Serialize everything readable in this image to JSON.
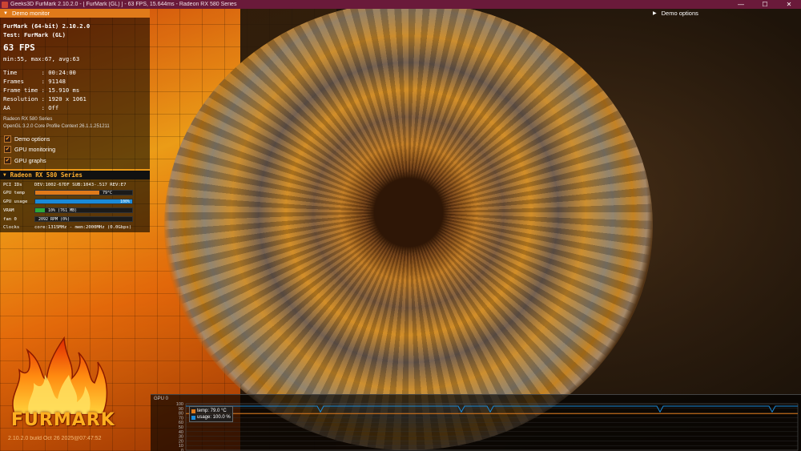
{
  "window": {
    "title": "Geeks3D FurMark 2.10.2.0 - [ FurMark (GL) ] - 63 FPS, 15.644ms - Radeon RX 580 Series",
    "controls": [
      "—",
      "☐",
      "✕"
    ]
  },
  "demo_monitor": {
    "header": "Demo monitor",
    "app_line": "FurMark (64-bit) 2.10.2.0",
    "test_line": "Test: FurMark (GL)",
    "fps": "63 FPS",
    "fps_stats": "min:55, max:67, avg:63",
    "stats": [
      {
        "label": "Time       ",
        "value": ": 00:24:00"
      },
      {
        "label": "Frames     ",
        "value": ": 91148"
      },
      {
        "label": "Frame time ",
        "value": ": 15.910 ms"
      },
      {
        "label": "Resolution ",
        "value": ": 1920 x 1061"
      },
      {
        "label": "AA         ",
        "value": ": Off"
      }
    ],
    "gpu_name": "Radeon RX 580 Series",
    "gl_context": "OpenGL 3.2.0 Core Profile Context 26.1.1.251211",
    "checkboxes": [
      {
        "label": "Demo options",
        "checked": true
      },
      {
        "label": "GPU monitoring",
        "checked": true
      },
      {
        "label": "GPU graphs",
        "checked": true
      }
    ]
  },
  "gpu_panel": {
    "header": "Radeon RX 580 Series",
    "pci_label": "PCI IDs",
    "pci_value": "DEV:1002-67DF SUB:1043-.517 REV:E7",
    "rows": [
      {
        "label": "GPU temp",
        "value": "79°C",
        "level": 0.66,
        "color": "#e07a1a"
      },
      {
        "label": "GPU usage",
        "value": "100%",
        "level": 1.0,
        "color": "#1a8ad8"
      },
      {
        "label": "VRAM",
        "value": "10% (761 MB)",
        "level": 0.1,
        "color": "#2aa83a"
      },
      {
        "label": "fan 0",
        "value": "2092 RPM (0%)",
        "level": 0,
        "color": "#888"
      }
    ],
    "clocks_label": "Clocks",
    "clocks_value": "core:1315MHz - mem:2000MHz (0.0Gbps)"
  },
  "demo_options": {
    "label": "Demo options"
  },
  "logo": {
    "text": "FURMARK",
    "build": "2.10.2.0 build Oct 26 2025@07:47:52"
  },
  "graph": {
    "title": "GPU 0",
    "y_ticks": [
      "100",
      "90",
      "80",
      "70",
      "60",
      "50",
      "40",
      "30",
      "20",
      "10",
      "0"
    ],
    "legend": [
      {
        "label": "temp: 79.0 °C",
        "color": "#e07a1a"
      },
      {
        "label": "usage: 100.0 %",
        "color": "#1a8ad8"
      }
    ],
    "series": {
      "temp_level": 79,
      "usage_level": 100
    }
  }
}
